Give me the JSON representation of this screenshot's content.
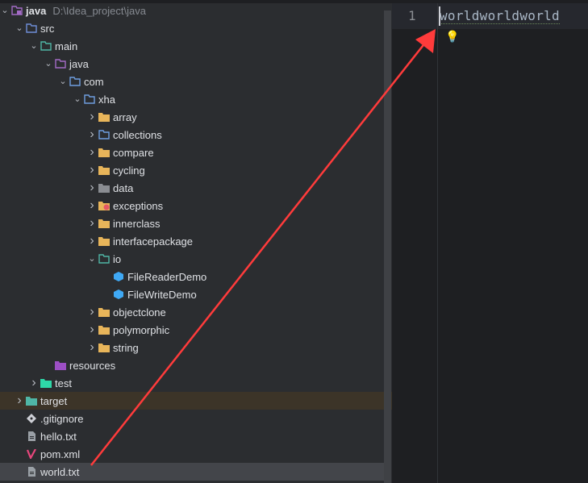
{
  "project": {
    "name": "java",
    "path": "D:\\Idea_project\\java"
  },
  "tree": [
    {
      "label": "src",
      "level": 1,
      "chevron": "down",
      "icon": "source-folder-icon",
      "color": "#6f8ed8"
    },
    {
      "label": "main",
      "level": 2,
      "chevron": "down",
      "icon": "module-folder-icon",
      "color": "#4fb6a6"
    },
    {
      "label": "java",
      "level": 3,
      "chevron": "down",
      "icon": "java-source-root-icon",
      "color": "#a36bc6"
    },
    {
      "label": "com",
      "level": 4,
      "chevron": "down",
      "icon": "package-folder-icon",
      "color": "#6f9fe0"
    },
    {
      "label": "xha",
      "level": 5,
      "chevron": "down",
      "icon": "package-folder-icon",
      "color": "#6f9fe0"
    },
    {
      "label": "array",
      "level": 6,
      "chevron": "right",
      "icon": "folder-icon",
      "color": "#e8b55a"
    },
    {
      "label": "collections",
      "level": 6,
      "chevron": "right",
      "icon": "package-folder-icon",
      "color": "#6f9fe0"
    },
    {
      "label": "compare",
      "level": 6,
      "chevron": "right",
      "icon": "folder-icon",
      "color": "#e8b55a"
    },
    {
      "label": "cycling",
      "level": 6,
      "chevron": "right",
      "icon": "folder-icon",
      "color": "#e8b55a"
    },
    {
      "label": "data",
      "level": 6,
      "chevron": "right",
      "icon": "data-folder-icon",
      "color": "#8a8d92"
    },
    {
      "label": "exceptions",
      "level": 6,
      "chevron": "right",
      "icon": "error-folder-icon",
      "color": "#e8b55a"
    },
    {
      "label": "innerclass",
      "level": 6,
      "chevron": "right",
      "icon": "folder-icon",
      "color": "#e8b55a"
    },
    {
      "label": "interfacepackage",
      "level": 6,
      "chevron": "right",
      "icon": "folder-icon",
      "color": "#e8b55a"
    },
    {
      "label": "io",
      "level": 6,
      "chevron": "down",
      "icon": "io-folder-icon",
      "color": "#4fb6a6"
    },
    {
      "label": "FileReaderDemo",
      "level": 7,
      "chevron": "",
      "icon": "java-class-icon",
      "color": "#3fa9f5"
    },
    {
      "label": "FileWriteDemo",
      "level": 7,
      "chevron": "",
      "icon": "java-class-icon",
      "color": "#3fa9f5"
    },
    {
      "label": "objectclone",
      "level": 6,
      "chevron": "right",
      "icon": "folder-icon",
      "color": "#e8b55a"
    },
    {
      "label": "polymorphic",
      "level": 6,
      "chevron": "right",
      "icon": "folder-icon",
      "color": "#e8b55a"
    },
    {
      "label": "string",
      "level": 6,
      "chevron": "right",
      "icon": "folder-icon",
      "color": "#e8b55a"
    },
    {
      "label": "resources",
      "level": 3,
      "chevron": "",
      "icon": "resources-folder-icon",
      "color": "#9c4fc4"
    },
    {
      "label": "test",
      "level": 2,
      "chevron": "right",
      "icon": "test-folder-icon",
      "color": "#2ed8a8"
    },
    {
      "label": "target",
      "level": 1,
      "chevron": "right",
      "icon": "excluded-folder-icon",
      "color": "#4fb6a6",
      "state": "highlighted"
    },
    {
      "label": ".gitignore",
      "level": 1,
      "chevron": "",
      "icon": "git-icon",
      "color": "#ced0d6"
    },
    {
      "label": "hello.txt",
      "level": 1,
      "chevron": "",
      "icon": "text-file-icon",
      "color": "#9aa0a6"
    },
    {
      "label": "pom.xml",
      "level": 1,
      "chevron": "",
      "icon": "maven-icon",
      "color": "#e8467c"
    },
    {
      "label": "world.txt",
      "level": 1,
      "chevron": "",
      "icon": "text-file-icon",
      "color": "#9aa0a6",
      "state": "selected"
    }
  ],
  "editor": {
    "line_number": "1",
    "line_text": "worldworldworld",
    "intention_icon": "lightbulb-icon"
  },
  "annotation": {
    "color": "#ff3b3b"
  }
}
